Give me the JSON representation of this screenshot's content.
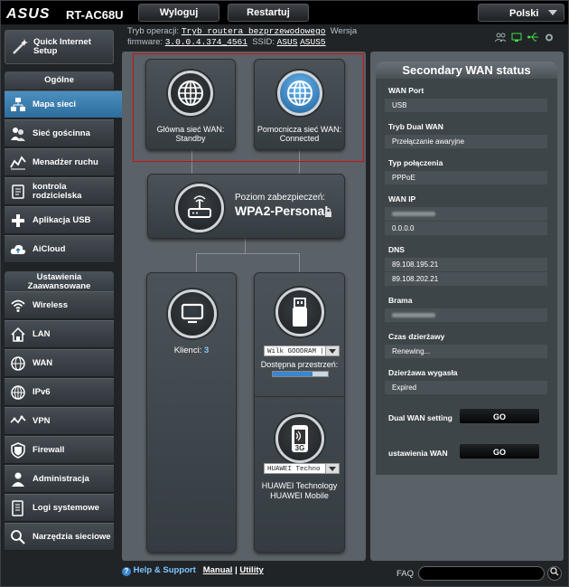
{
  "header": {
    "brand": "ASUS",
    "model": "RT-AC68U",
    "logout_label": "Wyloguj",
    "restart_label": "Restartuj",
    "language": "Polski"
  },
  "info": {
    "mode_label": "Tryb operacji:",
    "mode_value": "Tryb routera bezprzewodowego",
    "version_label": "Wersja",
    "firmware_label": "firmware:",
    "firmware_value": "3.0.0.4.374_4561",
    "ssid_label": "SSID:",
    "ssid_values": [
      "ASUS",
      "ASUS5"
    ]
  },
  "sidebar": {
    "quick_setup": "Quick Internet Setup",
    "general_header": "Ogólne",
    "general_items": [
      {
        "label": "Mapa sieci",
        "icon": "network-map-icon",
        "active": true
      },
      {
        "label": "Sieć gościnna",
        "icon": "guest-network-icon"
      },
      {
        "label": "Menadżer ruchu",
        "icon": "traffic-manager-icon"
      },
      {
        "label": "kontrola rodzicielska",
        "icon": "parental-control-icon"
      },
      {
        "label": "Aplikacja USB",
        "icon": "usb-app-icon"
      },
      {
        "label": "AiCloud",
        "icon": "aicloud-icon"
      }
    ],
    "advanced_header": "Ustawienia Zaawansowane",
    "advanced_items": [
      {
        "label": "Wireless",
        "icon": "wireless-icon"
      },
      {
        "label": "LAN",
        "icon": "lan-icon"
      },
      {
        "label": "WAN",
        "icon": "wan-icon"
      },
      {
        "label": "IPv6",
        "icon": "ipv6-icon"
      },
      {
        "label": "VPN",
        "icon": "vpn-icon"
      },
      {
        "label": "Firewall",
        "icon": "firewall-icon"
      },
      {
        "label": "Administracja",
        "icon": "admin-icon"
      },
      {
        "label": "Logi systemowe",
        "icon": "system-log-icon"
      },
      {
        "label": "Narzędzia sieciowe",
        "icon": "network-tools-icon"
      }
    ]
  },
  "map": {
    "primary_wan_label": "Główna sieć WAN:",
    "primary_wan_status": "Standby",
    "secondary_wan_label": "Pomocnicza sieć WAN:",
    "secondary_wan_status": "Connected",
    "security_label": "Poziom zabezpieczeń:",
    "security_value": "WPA2-Personal",
    "clients_label": "Klienci:",
    "clients_count": "3",
    "usb_device": "Wilk GOODRAM |",
    "storage_label": "Dostępna przestrzeń:",
    "storage_fraction": 0.72,
    "modem_device": "HUAWEI Techno",
    "modem_label_1": "HUAWEI Technology",
    "modem_label_2": "HUAWEI Mobile",
    "modem_badge": "3G"
  },
  "wan_status": {
    "title": "Secondary WAN status",
    "fields": [
      {
        "label": "WAN Port",
        "values": [
          "USB"
        ]
      },
      {
        "label": "Tryb Dual WAN",
        "values": [
          "Przełączanie awaryjne"
        ]
      },
      {
        "label": "Typ połączenia",
        "values": [
          "PPPoE"
        ]
      },
      {
        "label": "WAN IP",
        "values": [
          "",
          "0.0.0.0"
        ]
      },
      {
        "label": "DNS",
        "values": [
          "89.108.195.21",
          "89.108.202.21"
        ]
      },
      {
        "label": "Brama",
        "values": [
          ""
        ]
      },
      {
        "label": "Czas dzierżawy",
        "values": [
          "Renewing..."
        ]
      },
      {
        "label": "Dzierżawa wygasła",
        "values": [
          "Expired"
        ]
      }
    ],
    "dual_wan_setting_label": "Dual WAN setting",
    "wan_settings_label": "ustawienia WAN",
    "go_label": "GO"
  },
  "footer": {
    "help_label": "Help & Support",
    "manual_label": "Manual",
    "separator": "|",
    "utility_label": "Utility",
    "faq_label": "FAQ"
  },
  "colors": {
    "accent_blue": "#2c6d9c",
    "highlight_red": "#d01010",
    "usb_green": "#44dd44"
  }
}
